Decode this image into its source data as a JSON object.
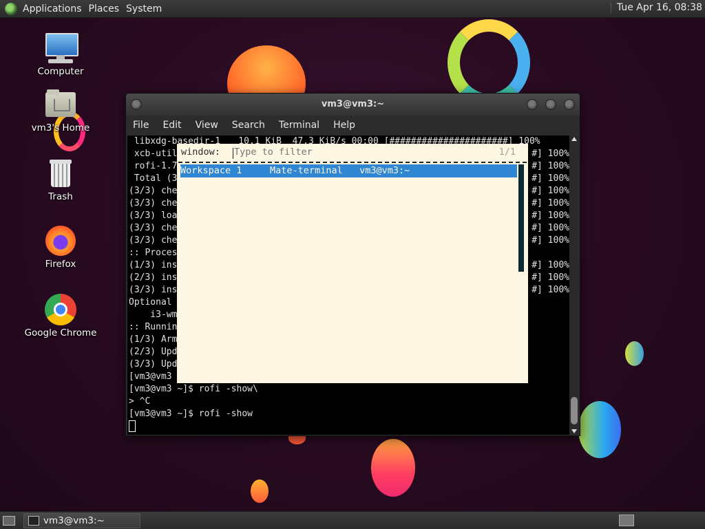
{
  "top_panel": {
    "menus": [
      "Applications",
      "Places",
      "System"
    ],
    "clock": "Tue Apr 16, 08:38"
  },
  "desktop": {
    "icons": [
      {
        "label": "Computer",
        "icon": "computer-icon"
      },
      {
        "label": "vm3's Home",
        "icon": "home-folder-icon"
      },
      {
        "label": "Trash",
        "icon": "trash-icon"
      },
      {
        "label": "Firefox",
        "icon": "firefox-icon"
      },
      {
        "label": "Google Chrome",
        "icon": "chrome-icon"
      }
    ]
  },
  "terminal": {
    "title": "vm3@vm3:~",
    "menu": [
      "File",
      "Edit",
      "View",
      "Search",
      "Terminal",
      "Help"
    ],
    "left_lines": [
      " libxdg-basedir-1",
      " xcb-util",
      " rofi-1.7",
      " Total (3",
      "(3/3) che",
      "(3/3) che",
      "(3/3) loa",
      "(3/3) che",
      "(3/3) che",
      ":: Proces",
      "(1/3) ins",
      "(2/3) ins",
      "(3/3) ins",
      "Optional",
      "    i3-wm",
      ":: Runnin",
      "(1/3) Arm",
      "(2/3) Upd",
      "(3/3) Upd",
      "[vm3@vm3"
    ],
    "first_line_mid": "    10.1 KiB  47.3 KiB/s 00:00 [######################] 100%",
    "right_lines": [
      "#] 100%",
      "#] 100%",
      "#] 100%",
      "#] 100%",
      "#] 100%",
      "#] 100%",
      "#] 100%",
      "#] 100%",
      "",
      "#] 100%",
      "#] 100%",
      "#] 100%"
    ],
    "bottom_lines": [
      "[vm3@vm3 ~]$ rofi -show\\",
      "> ^C",
      "[vm3@vm3 ~]$ rofi -show"
    ]
  },
  "rofi": {
    "prompt": "window:",
    "placeholder": "Type to filter",
    "count": "1/1",
    "entries": [
      {
        "workspace": "Workspace 1",
        "app": "Mate-terminal",
        "title": "vm3@vm3:~"
      }
    ],
    "entry_text": "Workspace 1     Mate-terminal   vm3@vm3:~"
  },
  "bottom_panel": {
    "task": "vm3@vm3:~"
  },
  "colors": {
    "rofi_bg": "#fdf6e3",
    "rofi_selected": "#2f86d2",
    "desktop_bg": "#2a0b22"
  }
}
